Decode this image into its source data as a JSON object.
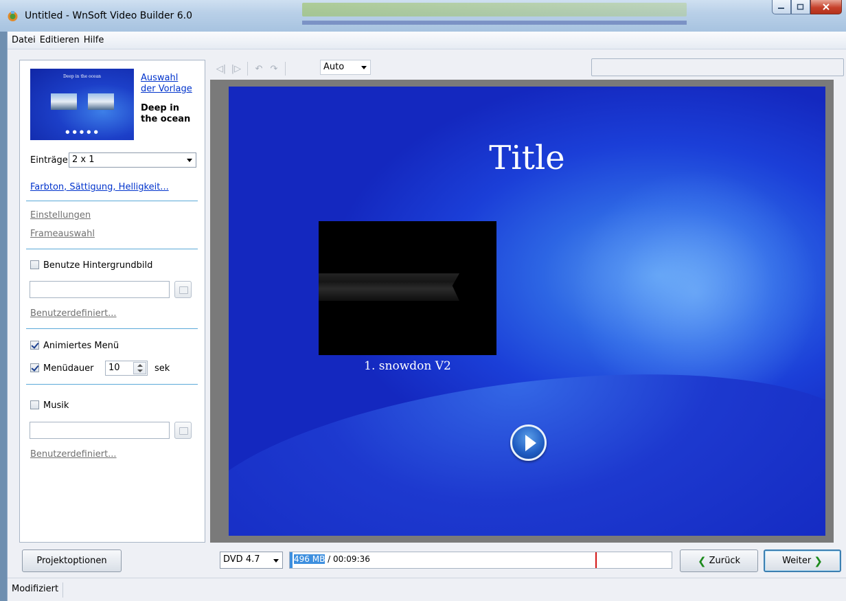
{
  "window": {
    "title": "Untitled - WnSoft Video Builder 6.0"
  },
  "menu": {
    "items": [
      "Datei",
      "Editieren",
      "Hilfe"
    ]
  },
  "template": {
    "thumb_title": "Deep in the ocean",
    "choose_link_line1": "Auswahl",
    "choose_link_line2": "der Vorlage",
    "name_line1": "Deep in",
    "name_line2": "the ocean"
  },
  "entries": {
    "label": "Einträge:",
    "value": "2 x 1"
  },
  "links": {
    "color": "Farbton, Sättigung, Helligkeit...",
    "settings": "Einstellungen",
    "frames": "Frameauswahl",
    "custom1": "Benutzerdefiniert...",
    "custom2": "Benutzerdefiniert..."
  },
  "background": {
    "label": "Benutze Hintergrundbild",
    "checked": false,
    "path": ""
  },
  "animated": {
    "label": "Animiertes Menü",
    "checked": true
  },
  "duration": {
    "label": "Menüdauer",
    "value": "10",
    "unit": "sek",
    "checked": true
  },
  "music": {
    "label": "Musik",
    "checked": false,
    "path": ""
  },
  "toolbar": {
    "zoom": "Auto"
  },
  "preview": {
    "title": "Title",
    "caption": "1. snowdon V2"
  },
  "bottom": {
    "project_options": "Projektoptionen",
    "disc": "DVD 4.7",
    "size_selected": "496 MB",
    "size_rest": " / 00:09:36",
    "back": "Zurück",
    "next": "Weiter"
  },
  "status": {
    "text": "Modifiziert"
  },
  "colors": {
    "accent": "#3d8fdf",
    "link": "#0033cc",
    "marker": "#d31414"
  }
}
